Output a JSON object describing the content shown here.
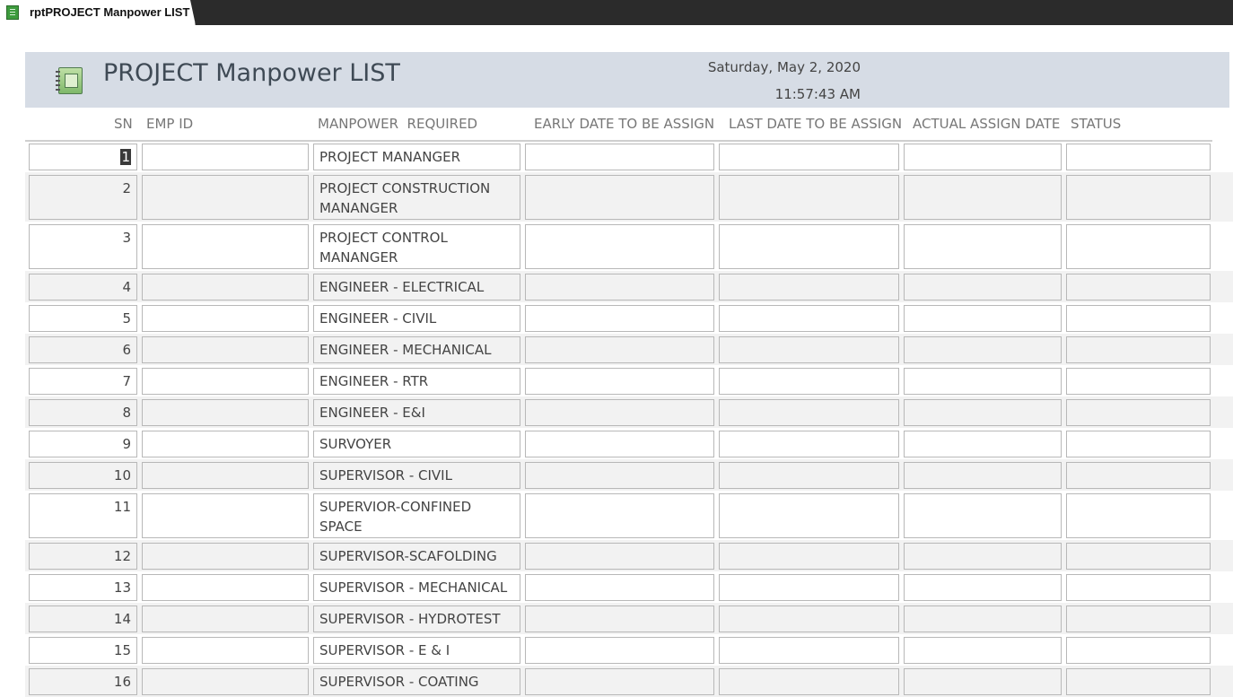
{
  "tab": {
    "label": "rptPROJECT Manpower LIST",
    "icon": "report-icon"
  },
  "header": {
    "title": "PROJECT Manpower LIST",
    "date": "Saturday, May 2, 2020",
    "time": "11:57:43 AM",
    "background": "#d6dce5"
  },
  "columns": {
    "sn": "SN",
    "emp_id": "EMP ID",
    "manpower": "MANPOWER  REQUIRED",
    "early": "EARLY DATE TO BE ASSIGN",
    "last": "LAST DATE TO BE ASSIGN",
    "actual": "ACTUAL ASSIGN DATE",
    "status": "STATUS"
  },
  "rows": [
    {
      "sn": "1",
      "emp_id": "",
      "manpower": "PROJECT MANANGER",
      "early": "",
      "last": "",
      "actual": "",
      "status": ""
    },
    {
      "sn": "2",
      "emp_id": "",
      "manpower": "PROJECT CONSTRUCTION MANANGER",
      "early": "",
      "last": "",
      "actual": "",
      "status": ""
    },
    {
      "sn": "3",
      "emp_id": "",
      "manpower": "PROJECT CONTROL MANANGER",
      "early": "",
      "last": "",
      "actual": "",
      "status": ""
    },
    {
      "sn": "4",
      "emp_id": "",
      "manpower": "ENGINEER - ELECTRICAL",
      "early": "",
      "last": "",
      "actual": "",
      "status": ""
    },
    {
      "sn": "5",
      "emp_id": "",
      "manpower": "ENGINEER - CIVIL",
      "early": "",
      "last": "",
      "actual": "",
      "status": ""
    },
    {
      "sn": "6",
      "emp_id": "",
      "manpower": "ENGINEER - MECHANICAL",
      "early": "",
      "last": "",
      "actual": "",
      "status": ""
    },
    {
      "sn": "7",
      "emp_id": "",
      "manpower": "ENGINEER - RTR",
      "early": "",
      "last": "",
      "actual": "",
      "status": ""
    },
    {
      "sn": "8",
      "emp_id": "",
      "manpower": "ENGINEER - E&I",
      "early": "",
      "last": "",
      "actual": "",
      "status": ""
    },
    {
      "sn": "9",
      "emp_id": "",
      "manpower": "SURVOYER",
      "early": "",
      "last": "",
      "actual": "",
      "status": ""
    },
    {
      "sn": "10",
      "emp_id": "",
      "manpower": "SUPERVISOR - CIVIL",
      "early": "",
      "last": "",
      "actual": "",
      "status": ""
    },
    {
      "sn": "11",
      "emp_id": "",
      "manpower": " SUPERVIOR-CONFINED SPACE",
      "early": "",
      "last": "",
      "actual": "",
      "status": ""
    },
    {
      "sn": "12",
      "emp_id": "",
      "manpower": " SUPERVISOR-SCAFOLDING",
      "early": "",
      "last": "",
      "actual": "",
      "status": ""
    },
    {
      "sn": "13",
      "emp_id": "",
      "manpower": "SUPERVISOR - MECHANICAL",
      "early": "",
      "last": "",
      "actual": "",
      "status": ""
    },
    {
      "sn": "14",
      "emp_id": "",
      "manpower": "SUPERVISOR - HYDROTEST",
      "early": "",
      "last": "",
      "actual": "",
      "status": ""
    },
    {
      "sn": "15",
      "emp_id": "",
      "manpower": "SUPERVISOR - E & I",
      "early": "",
      "last": "",
      "actual": "",
      "status": ""
    },
    {
      "sn": "16",
      "emp_id": "",
      "manpower": "SUPERVISOR - COATING",
      "early": "",
      "last": "",
      "actual": "",
      "status": ""
    }
  ]
}
